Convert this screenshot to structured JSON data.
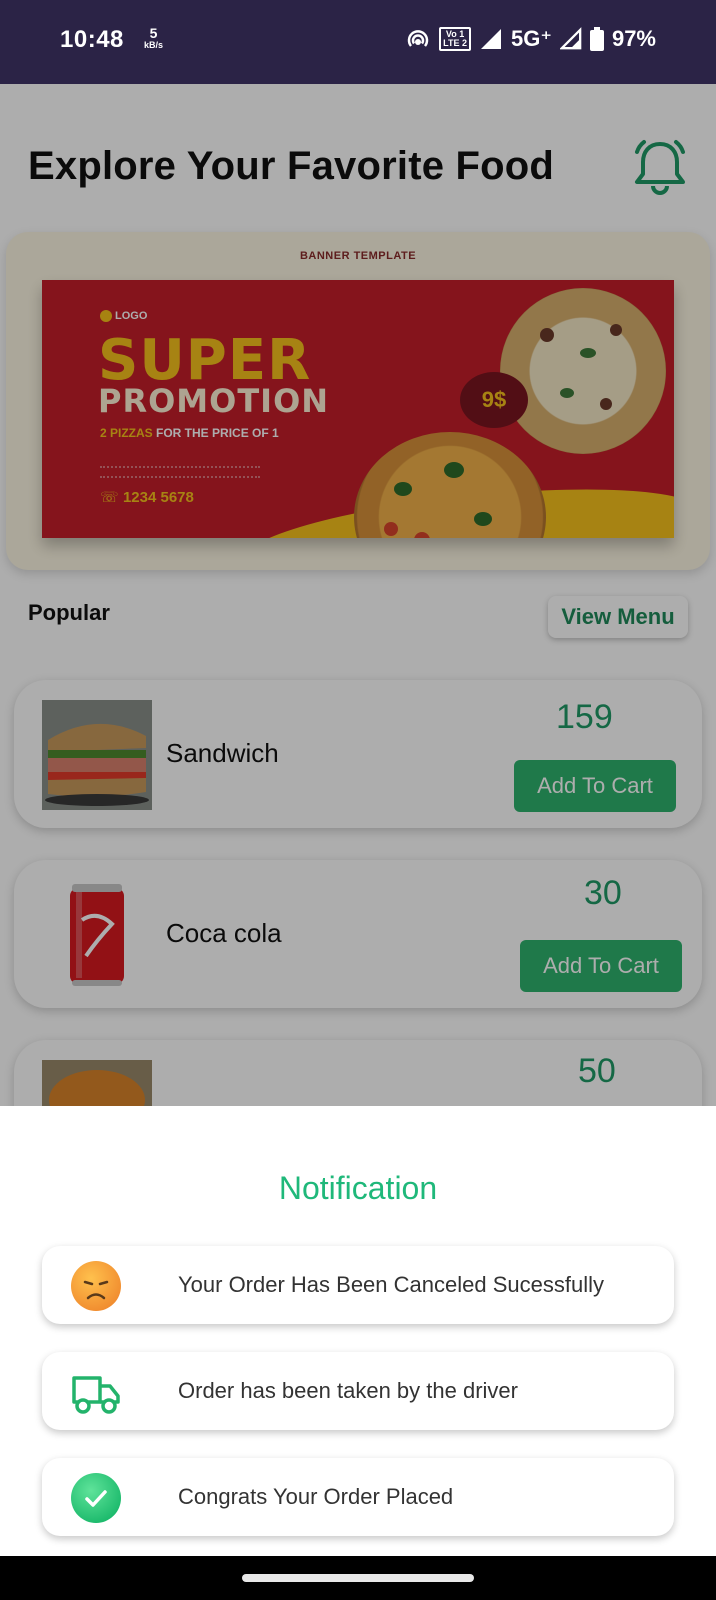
{
  "status_bar": {
    "time": "10:48",
    "net_speed_value": "5",
    "net_speed_unit": "kB/s",
    "volte_top": "Vo 1",
    "volte_bottom": "LTE 2",
    "network": "5G⁺",
    "battery": "97%"
  },
  "header": {
    "title": "Explore Your Favorite Food",
    "accent_color": "#1f9a66"
  },
  "banner": {
    "tag": "BANNER TEMPLATE",
    "logo": "LOGO",
    "headline": "SUPER",
    "headline2": "PROMOTION",
    "sub_highlight": "2 PIZZAS",
    "sub_rest": " FOR THE PRICE OF 1",
    "phone": "1234 5678",
    "price": "9$"
  },
  "popular": {
    "label": "Popular",
    "view_menu": "View Menu"
  },
  "foods": [
    {
      "name": "Sandwich",
      "price": "159",
      "button": "Add To Cart"
    },
    {
      "name": "Coca cola",
      "price": "30",
      "button": "Add To Cart"
    },
    {
      "name": "",
      "price": "50",
      "button": ""
    }
  ],
  "sheet": {
    "title": "Notification",
    "items": [
      {
        "icon": "sad-face-icon",
        "text": "Your Order Has Been Canceled Sucessfully"
      },
      {
        "icon": "delivery-truck-icon",
        "text": "Order has been taken by the driver"
      },
      {
        "icon": "check-circle-icon",
        "text": "Congrats Your Order Placed"
      }
    ]
  }
}
